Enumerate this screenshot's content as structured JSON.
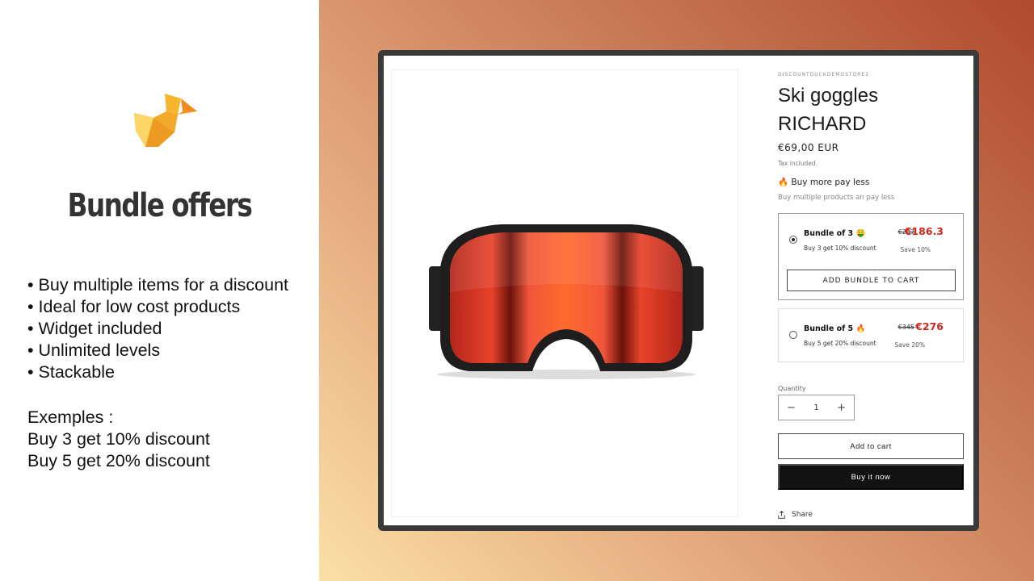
{
  "left": {
    "headline": "Bundle offers",
    "features": [
      "Buy multiple items for a discount",
      "Ideal for low cost products",
      "Widget included",
      "Unlimited levels",
      "Stackable"
    ],
    "examples": [
      "Exemples :",
      "Buy 3 get 10% discount",
      "Buy 5 get 20% discount"
    ]
  },
  "product": {
    "store": "DISCOUNTDUCKDEMOSTORE2",
    "title_line1": "Ski goggles",
    "title_line2": "RICHARD",
    "price": "€69,00 EUR",
    "tax": "Tax included.",
    "promo_title": "🔥 Buy more pay less",
    "promo_subtitle": "Buy multiple products an pay less",
    "bundles": [
      {
        "name": "Bundle of 3 🤑",
        "description": "Buy 3 get 10% discount",
        "old_price": "€207",
        "new_price": "€186.3",
        "save": "Save 10%",
        "selected": true,
        "button": "ADD BUNDLE TO CART"
      },
      {
        "name": "Bundle of 5 🔥",
        "description": "Buy 5 get 20% discount",
        "old_price": "€345",
        "new_price": "€276",
        "save": "Save 20%",
        "selected": false
      }
    ],
    "quantity_label": "Quantity",
    "quantity_value": "1",
    "quantity_minus": "−",
    "quantity_plus": "+",
    "add_to_cart": "Add to cart",
    "buy_now": "Buy it now",
    "share": "Share"
  },
  "colors": {
    "sale_red": "#d0261c",
    "buy_button": "#121212",
    "duck_yellow": "#f5b82e",
    "duck_orange": "#ef8a1f"
  },
  "icons": {
    "logo": "duck-logo-icon",
    "share": "share-icon"
  }
}
